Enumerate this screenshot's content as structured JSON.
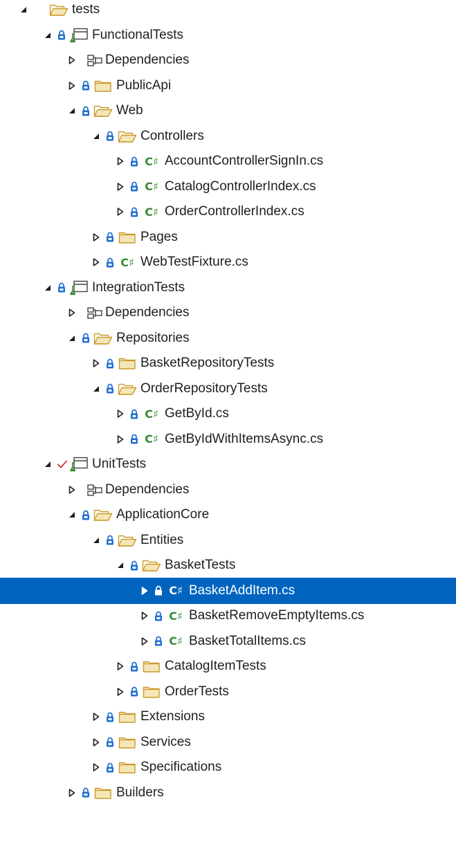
{
  "colors": {
    "selection_bg": "#0064bf",
    "folder_fill": "#f5e6b8",
    "folder_stroke": "#c99b2a",
    "lock": "#1f6fd1",
    "csharp": "#388a34",
    "check": "#d13438",
    "test_flask": "#388a34"
  },
  "tree": [
    {
      "label": "tests",
      "depth": 0,
      "expanded": true,
      "icon": "open-folder-icon",
      "lock": false
    },
    {
      "label": "FunctionalTests",
      "depth": 1,
      "expanded": true,
      "icon": "test-project-icon",
      "lock": true
    },
    {
      "label": "Dependencies",
      "depth": 2,
      "expanded": false,
      "icon": "dependencies-icon",
      "lock": false
    },
    {
      "label": "PublicApi",
      "depth": 2,
      "expanded": false,
      "icon": "folder-icon",
      "lock": true
    },
    {
      "label": "Web",
      "depth": 2,
      "expanded": true,
      "icon": "open-folder-icon",
      "lock": true
    },
    {
      "label": "Controllers",
      "depth": 3,
      "expanded": true,
      "icon": "open-folder-icon",
      "lock": true
    },
    {
      "label": "AccountControllerSignIn.cs",
      "depth": 4,
      "expanded": false,
      "icon": "csharp-file-icon",
      "lock": true
    },
    {
      "label": "CatalogControllerIndex.cs",
      "depth": 4,
      "expanded": false,
      "icon": "csharp-file-icon",
      "lock": true
    },
    {
      "label": "OrderControllerIndex.cs",
      "depth": 4,
      "expanded": false,
      "icon": "csharp-file-icon",
      "lock": true
    },
    {
      "label": "Pages",
      "depth": 3,
      "expanded": false,
      "icon": "folder-icon",
      "lock": true
    },
    {
      "label": "WebTestFixture.cs",
      "depth": 3,
      "expanded": false,
      "icon": "csharp-file-icon",
      "lock": true
    },
    {
      "label": "IntegrationTests",
      "depth": 1,
      "expanded": true,
      "icon": "test-project-icon",
      "lock": true
    },
    {
      "label": "Dependencies",
      "depth": 2,
      "expanded": false,
      "icon": "dependencies-icon",
      "lock": false
    },
    {
      "label": "Repositories",
      "depth": 2,
      "expanded": true,
      "icon": "open-folder-icon",
      "lock": true
    },
    {
      "label": "BasketRepositoryTests",
      "depth": 3,
      "expanded": false,
      "icon": "folder-icon",
      "lock": true
    },
    {
      "label": "OrderRepositoryTests",
      "depth": 3,
      "expanded": true,
      "icon": "open-folder-icon",
      "lock": true
    },
    {
      "label": "GetById.cs",
      "depth": 4,
      "expanded": false,
      "icon": "csharp-file-icon",
      "lock": true
    },
    {
      "label": "GetByIdWithItemsAsync.cs",
      "depth": 4,
      "expanded": false,
      "icon": "csharp-file-icon",
      "lock": true
    },
    {
      "label": "UnitTests",
      "depth": 1,
      "expanded": true,
      "icon": "test-project-icon",
      "lock": false,
      "check": true
    },
    {
      "label": "Dependencies",
      "depth": 2,
      "expanded": false,
      "icon": "dependencies-icon",
      "lock": false
    },
    {
      "label": "ApplicationCore",
      "depth": 2,
      "expanded": true,
      "icon": "open-folder-icon",
      "lock": true
    },
    {
      "label": "Entities",
      "depth": 3,
      "expanded": true,
      "icon": "open-folder-icon",
      "lock": true
    },
    {
      "label": "BasketTests",
      "depth": 4,
      "expanded": true,
      "icon": "open-folder-icon",
      "lock": true
    },
    {
      "label": "BasketAddItem.cs",
      "depth": 5,
      "expanded": false,
      "icon": "csharp-file-icon",
      "lock": true,
      "selected": true
    },
    {
      "label": "BasketRemoveEmptyItems.cs",
      "depth": 5,
      "expanded": false,
      "icon": "csharp-file-icon",
      "lock": true
    },
    {
      "label": "BasketTotalItems.cs",
      "depth": 5,
      "expanded": false,
      "icon": "csharp-file-icon",
      "lock": true
    },
    {
      "label": "CatalogItemTests",
      "depth": 4,
      "expanded": false,
      "icon": "folder-icon",
      "lock": true
    },
    {
      "label": "OrderTests",
      "depth": 4,
      "expanded": false,
      "icon": "folder-icon",
      "lock": true
    },
    {
      "label": "Extensions",
      "depth": 3,
      "expanded": false,
      "icon": "folder-icon",
      "lock": true
    },
    {
      "label": "Services",
      "depth": 3,
      "expanded": false,
      "icon": "folder-icon",
      "lock": true
    },
    {
      "label": "Specifications",
      "depth": 3,
      "expanded": false,
      "icon": "folder-icon",
      "lock": true
    },
    {
      "label": "Builders",
      "depth": 2,
      "expanded": false,
      "icon": "folder-icon",
      "lock": true
    }
  ]
}
